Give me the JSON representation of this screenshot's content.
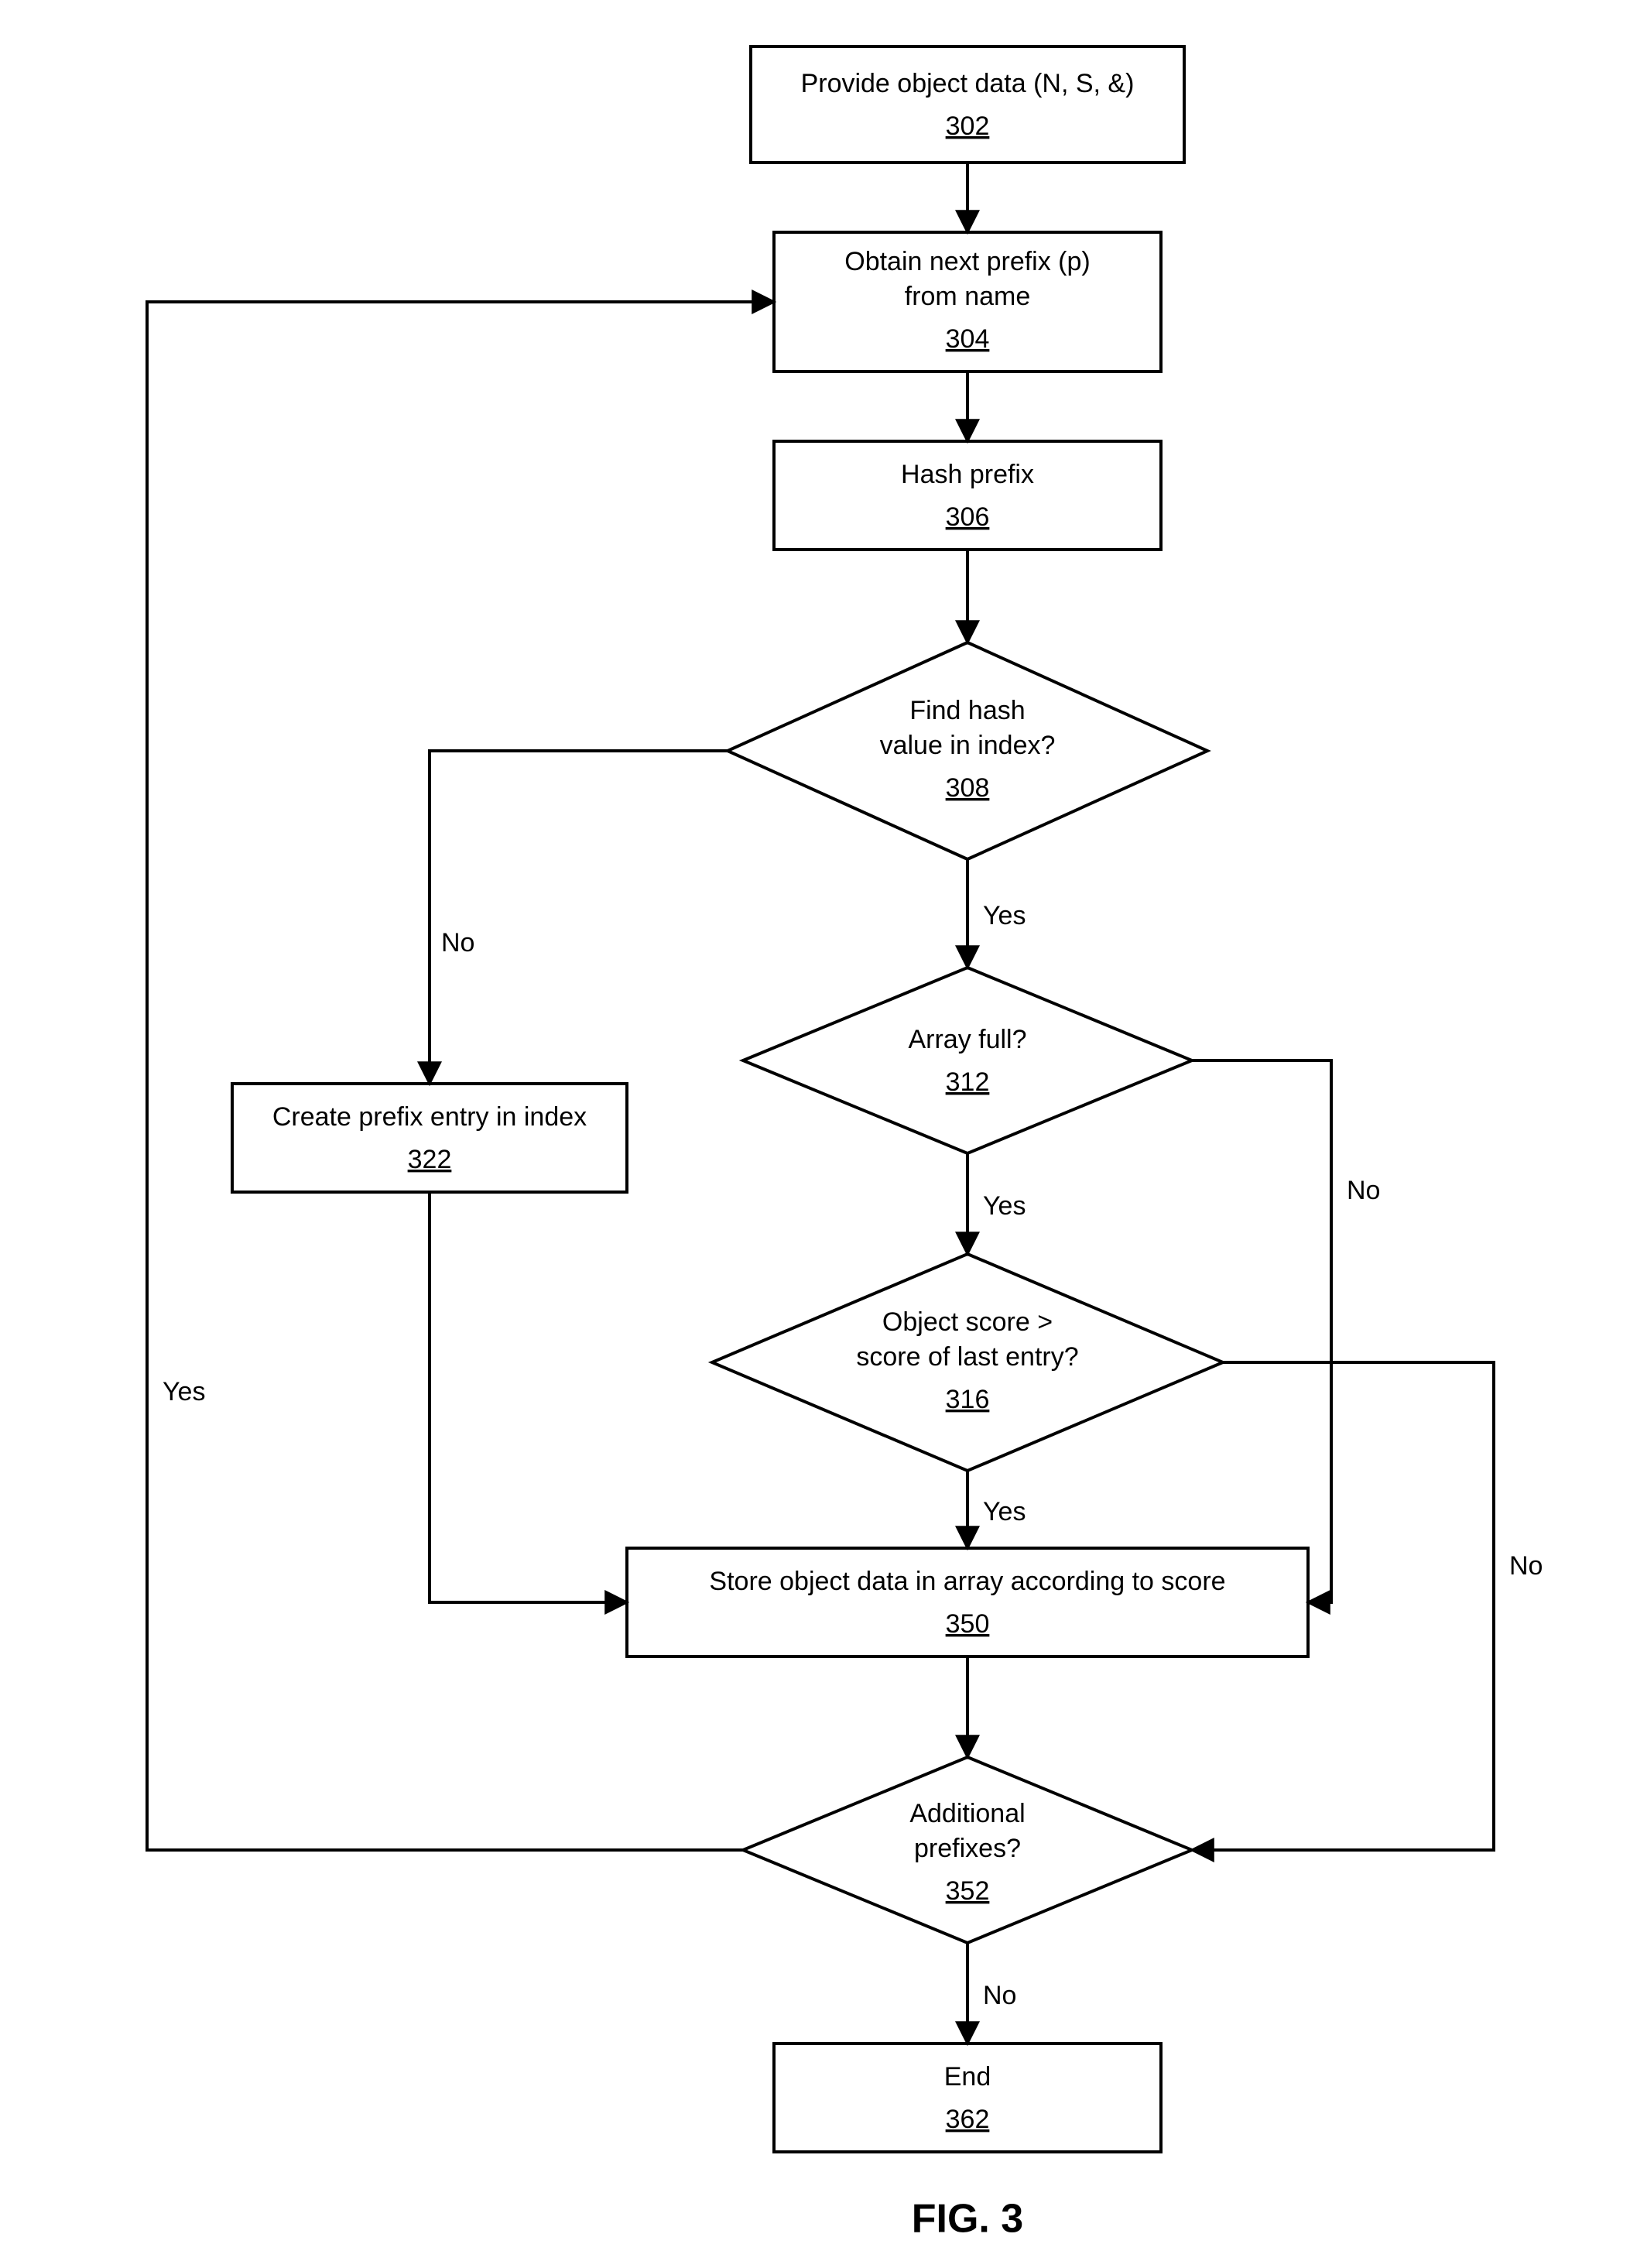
{
  "figure_label": "FIG. 3",
  "nodes": {
    "n302": {
      "line1": "Provide object data (N, S, &)",
      "ref": "302"
    },
    "n304": {
      "line1": "Obtain next prefix (p)",
      "line2": "from name",
      "ref": "304"
    },
    "n306": {
      "line1": "Hash prefix",
      "ref": "306"
    },
    "n308": {
      "line1": "Find hash",
      "line2": "value in index?",
      "ref": "308"
    },
    "n312": {
      "line1": "Array full?",
      "ref": "312"
    },
    "n316": {
      "line1": "Object score >",
      "line2": "score of last entry?",
      "ref": "316"
    },
    "n322": {
      "line1": "Create prefix entry in index",
      "ref": "322"
    },
    "n350": {
      "line1": "Store object data in array according to score",
      "ref": "350"
    },
    "n352": {
      "line1": "Additional",
      "line2": "prefixes?",
      "ref": "352"
    },
    "n362": {
      "line1": "End",
      "ref": "362"
    }
  },
  "edges": {
    "e308_yes": "Yes",
    "e308_no": "No",
    "e312_yes": "Yes",
    "e312_no": "No",
    "e316_yes": "Yes",
    "e316_no": "No",
    "e352_yes": "Yes",
    "e352_no": "No"
  }
}
